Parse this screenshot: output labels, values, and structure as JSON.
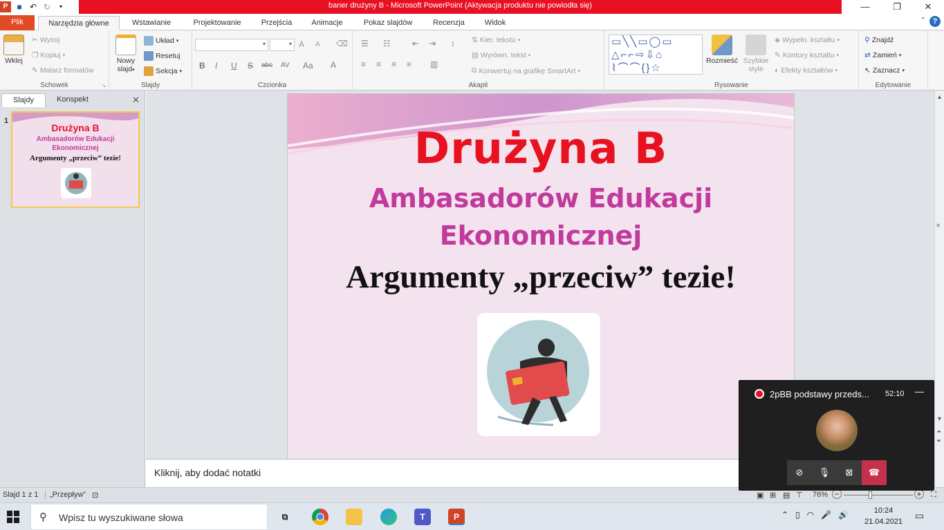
{
  "window": {
    "title": "baner drużyny B  -  Microsoft PowerPoint (Aktywacja produktu nie powiodła się)",
    "brand_color": "#e81123",
    "controls": [
      "—",
      "❐",
      "✕"
    ]
  },
  "tabs": [
    "Plik",
    "Narzędzia główne",
    "Wstawianie",
    "Projektowanie",
    "Przejścia",
    "Animacje",
    "Pokaz slajdów",
    "Recenzja",
    "Widok"
  ],
  "active_tab": "Narzędzia główne",
  "ribbon": {
    "clipboard": {
      "label": "Schowek",
      "paste": "Wklej",
      "cut": "Wytnij",
      "copy": "Kopiuj",
      "format_painter": "Malarz formatów"
    },
    "slides": {
      "label": "Slajdy",
      "new_slide_line1": "Nowy",
      "new_slide_line2": "slajd",
      "layout": "Układ",
      "reset": "Resetuj",
      "section": "Sekcja"
    },
    "font": {
      "label": "Czcionka",
      "bold": "B",
      "italic": "I",
      "underline": "U",
      "strike": "S",
      "abc": "abc",
      "spacing": "AV",
      "case": "Aa",
      "grow": "A",
      "shrink": "A",
      "color": "A"
    },
    "paragraph": {
      "label": "Akapit",
      "text_direction": "Kier. tekstu",
      "align_text": "Wyrówn. tekst",
      "smartart": "Konwertuj na grafikę SmartArt"
    },
    "drawing": {
      "label": "Rysowanie",
      "arrange": "Rozmieść",
      "quick_styles_line1": "Szybkie",
      "quick_styles_line2": "style",
      "shape_fill": "Wypełn. kształtu",
      "shape_outline": "Kontury kształtu",
      "shape_effects": "Efekty kształtów"
    },
    "editing": {
      "label": "Edytowanie",
      "find": "Znajdź",
      "replace": "Zamień",
      "select": "Zaznacz"
    }
  },
  "left_panel": {
    "tabs": [
      "Slajdy",
      "Konspekt"
    ],
    "close": "✕",
    "slide_number": "1",
    "thumb": {
      "title": "Drużyna  B",
      "subtitle_line1": "Ambasadorów Edukacji",
      "subtitle_line2": "Ekonomicznej",
      "line3": "Argumenty „przeciw” tezie!"
    }
  },
  "slide": {
    "title": "Drużyna  B",
    "subtitle_line1": "Ambasadorów Edukacji",
    "subtitle_line2": "Ekonomicznej",
    "line3": "Argumenty „przeciw” tezie!",
    "title_color": "#e8111f",
    "subtitle_color": "#c13a9c",
    "image_icon": "thief-with-credit-card-illustration"
  },
  "notes": {
    "placeholder": "Kliknij, aby dodać notatki"
  },
  "status_bar": {
    "slide_info": "Slajd 1 z 1",
    "theme": "„Przepływ”",
    "zoom": "76%",
    "zoom_minus": "−",
    "zoom_plus": "+"
  },
  "call": {
    "title": "2pBB podstawy przeds...",
    "time": "52:10",
    "minimize": "—",
    "icons": [
      "camera-off-icon",
      "mic-icon",
      "share-screen-icon",
      "hang-up-icon"
    ]
  },
  "taskbar": {
    "search_placeholder": "Wpisz tu wyszukiwane słowa",
    "apps": [
      "task-view",
      "chrome",
      "file-explorer",
      "edge",
      "teams",
      "powerpoint"
    ],
    "time": "10:24",
    "date": "21.04.2021"
  }
}
